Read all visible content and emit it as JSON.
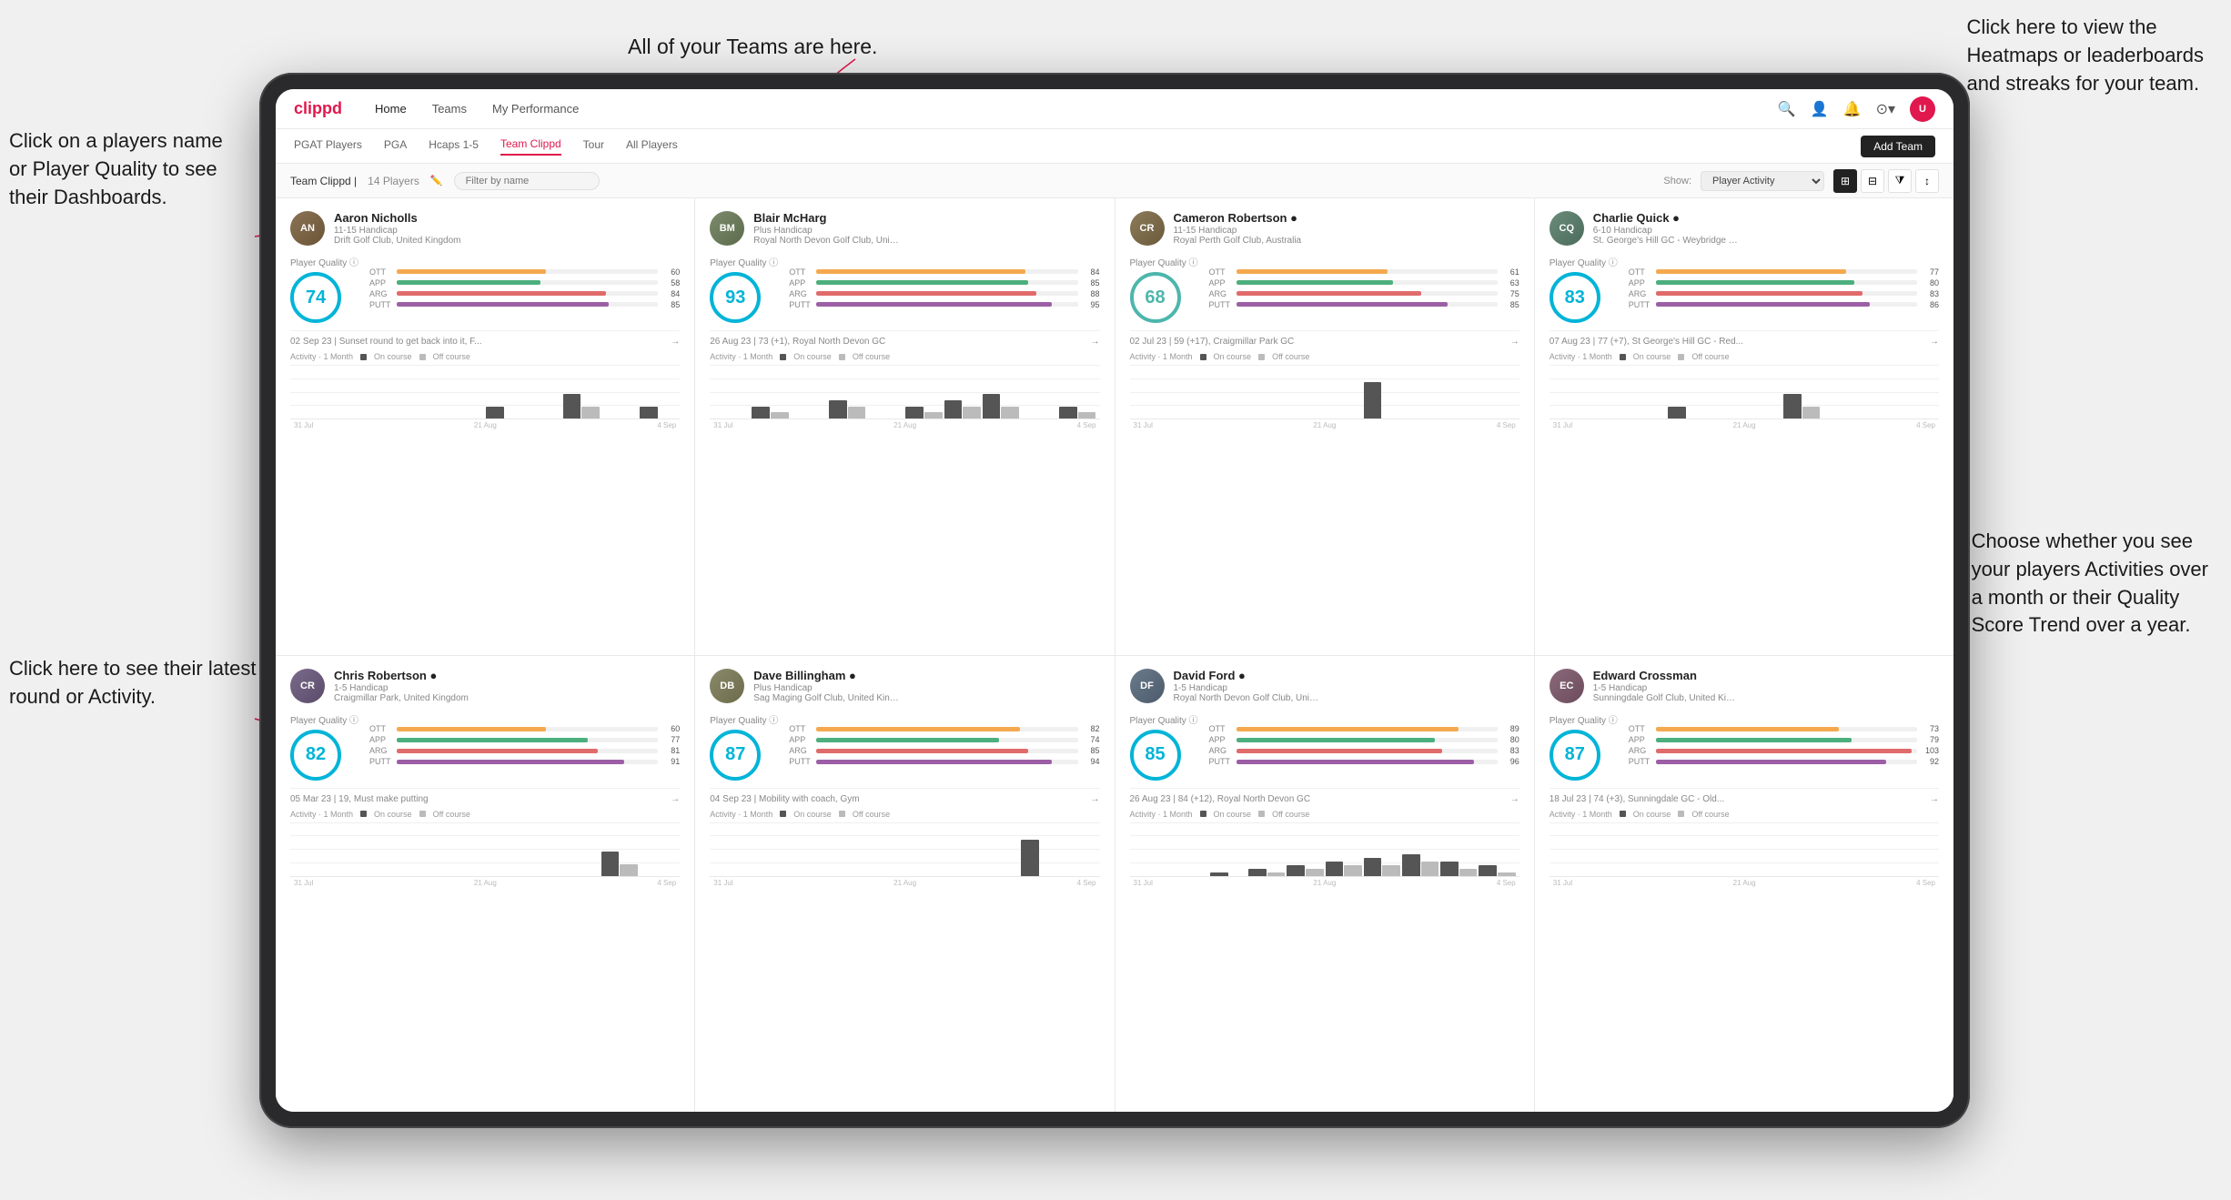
{
  "annotations": {
    "top_teams": "All of your Teams are here.",
    "top_right": "Click here to view the\nHeatmaps or leaderboards\nand streaks for your team.",
    "left_name": "Click on a players name\nor Player Quality to see\ntheir Dashboards.",
    "left_activity": "Click here to see their latest\nround or Activity.",
    "right_bottom": "Choose whether you see\nyour players Activities over\na month or their Quality\nScore Trend over a year."
  },
  "nav": {
    "logo": "clippd",
    "items": [
      "Home",
      "Teams",
      "My Performance"
    ],
    "icons": [
      "🔍",
      "👤",
      "🔔",
      "⊙",
      "👤"
    ]
  },
  "subnav": {
    "items": [
      "PGAT Players",
      "PGA",
      "Hcaps 1-5",
      "Team Clippd",
      "Tour",
      "All Players"
    ],
    "active": "Team Clippd",
    "add_team": "Add Team"
  },
  "teambar": {
    "title": "Team Clippd",
    "count": "14 Players",
    "filter_placeholder": "Filter by name",
    "show_label": "Show:",
    "show_option": "Player Activity",
    "views": [
      "grid-2",
      "grid-3",
      "filter",
      "sort"
    ]
  },
  "players": [
    {
      "name": "Aaron Nicholls",
      "handicap": "11-15 Handicap",
      "club": "Drift Golf Club, United Kingdom",
      "quality": 74,
      "quality_color": "#00b4d8",
      "stats": {
        "ott": 60,
        "app": 58,
        "arg": 84,
        "putt": 85
      },
      "latest": "02 Sep 23 | Sunset round to get back into it, F...",
      "activity_bars": [
        [
          0,
          0
        ],
        [
          0,
          0
        ],
        [
          0,
          0
        ],
        [
          0,
          0
        ],
        [
          0,
          0
        ],
        [
          1,
          0
        ],
        [
          0,
          0
        ],
        [
          2,
          1
        ],
        [
          0,
          0
        ],
        [
          1,
          0
        ]
      ],
      "dates": [
        "31 Jul",
        "21 Aug",
        "4 Sep"
      ],
      "avatar_class": "avatar-a",
      "avatar_letter": "AN"
    },
    {
      "name": "Blair McHarg",
      "handicap": "Plus Handicap",
      "club": "Royal North Devon Golf Club, United Kin...",
      "quality": 93,
      "quality_color": "#00b4d8",
      "stats": {
        "ott": 84,
        "app": 85,
        "arg": 88,
        "putt": 95
      },
      "latest": "26 Aug 23 | 73 (+1), Royal North Devon GC",
      "activity_bars": [
        [
          0,
          0
        ],
        [
          2,
          1
        ],
        [
          0,
          0
        ],
        [
          3,
          2
        ],
        [
          0,
          0
        ],
        [
          2,
          1
        ],
        [
          3,
          2
        ],
        [
          4,
          2
        ],
        [
          0,
          0
        ],
        [
          2,
          1
        ]
      ],
      "dates": [
        "31 Jul",
        "21 Aug",
        "4 Sep"
      ],
      "avatar_class": "avatar-b",
      "avatar_letter": "BM"
    },
    {
      "name": "Cameron Robertson",
      "handicap": "11-15 Handicap",
      "club": "Royal Perth Golf Club, Australia",
      "quality": 68,
      "quality_color": "#4db6ac",
      "stats": {
        "ott": 61,
        "app": 63,
        "arg": 75,
        "putt": 85
      },
      "latest": "02 Jul 23 | 59 (+17), Craigmillar Park GC",
      "activity_bars": [
        [
          0,
          0
        ],
        [
          0,
          0
        ],
        [
          0,
          0
        ],
        [
          0,
          0
        ],
        [
          0,
          0
        ],
        [
          0,
          0
        ],
        [
          1,
          0
        ],
        [
          0,
          0
        ],
        [
          0,
          0
        ],
        [
          0,
          0
        ]
      ],
      "dates": [
        "31 Jul",
        "21 Aug",
        "4 Sep"
      ],
      "avatar_class": "avatar-c",
      "avatar_letter": "CR"
    },
    {
      "name": "Charlie Quick",
      "handicap": "6-10 Handicap",
      "club": "St. George's Hill GC - Weybridge - Surrey...",
      "quality": 83,
      "quality_color": "#00b4d8",
      "stats": {
        "ott": 77,
        "app": 80,
        "arg": 83,
        "putt": 86
      },
      "latest": "07 Aug 23 | 77 (+7), St George's Hill GC - Red...",
      "activity_bars": [
        [
          0,
          0
        ],
        [
          0,
          0
        ],
        [
          0,
          0
        ],
        [
          1,
          0
        ],
        [
          0,
          0
        ],
        [
          0,
          0
        ],
        [
          2,
          1
        ],
        [
          0,
          0
        ],
        [
          0,
          0
        ],
        [
          0,
          0
        ]
      ],
      "dates": [
        "31 Jul",
        "21 Aug",
        "4 Sep"
      ],
      "avatar_class": "avatar-d",
      "avatar_letter": "CQ"
    },
    {
      "name": "Chris Robertson",
      "handicap": "1-5 Handicap",
      "club": "Craigmillar Park, United Kingdom",
      "quality": 82,
      "quality_color": "#00b4d8",
      "stats": {
        "ott": 60,
        "app": 77,
        "arg": 81,
        "putt": 91
      },
      "latest": "05 Mar 23 | 19, Must make putting",
      "activity_bars": [
        [
          0,
          0
        ],
        [
          0,
          0
        ],
        [
          0,
          0
        ],
        [
          0,
          0
        ],
        [
          0,
          0
        ],
        [
          0,
          0
        ],
        [
          0,
          0
        ],
        [
          0,
          0
        ],
        [
          2,
          1
        ],
        [
          0,
          0
        ]
      ],
      "dates": [
        "31 Jul",
        "21 Aug",
        "4 Sep"
      ],
      "avatar_class": "avatar-e",
      "avatar_letter": "CR"
    },
    {
      "name": "Dave Billingham",
      "handicap": "Plus Handicap",
      "club": "Sag Maging Golf Club, United Kingdom",
      "quality": 87,
      "quality_color": "#00b4d8",
      "stats": {
        "ott": 82,
        "app": 74,
        "arg": 85,
        "putt": 94
      },
      "latest": "04 Sep 23 | Mobility with coach, Gym",
      "activity_bars": [
        [
          0,
          0
        ],
        [
          0,
          0
        ],
        [
          0,
          0
        ],
        [
          0,
          0
        ],
        [
          0,
          0
        ],
        [
          0,
          0
        ],
        [
          0,
          0
        ],
        [
          0,
          0
        ],
        [
          1,
          0
        ],
        [
          0,
          0
        ]
      ],
      "dates": [
        "31 Jul",
        "21 Aug",
        "4 Sep"
      ],
      "avatar_class": "avatar-f",
      "avatar_letter": "DB"
    },
    {
      "name": "David Ford",
      "handicap": "1-5 Handicap",
      "club": "Royal North Devon Golf Club, United Kiti...",
      "quality": 85,
      "quality_color": "#00b4d8",
      "stats": {
        "ott": 89,
        "app": 80,
        "arg": 83,
        "putt": 96
      },
      "latest": "26 Aug 23 | 84 (+12), Royal North Devon GC",
      "activity_bars": [
        [
          0,
          0
        ],
        [
          0,
          0
        ],
        [
          1,
          0
        ],
        [
          2,
          1
        ],
        [
          3,
          2
        ],
        [
          4,
          3
        ],
        [
          5,
          3
        ],
        [
          6,
          4
        ],
        [
          4,
          2
        ],
        [
          3,
          1
        ]
      ],
      "dates": [
        "31 Jul",
        "21 Aug",
        "4 Sep"
      ],
      "avatar_class": "avatar-g",
      "avatar_letter": "DF"
    },
    {
      "name": "Edward Crossman",
      "handicap": "1-5 Handicap",
      "club": "Sunningdale Golf Club, United Kingdom",
      "quality": 87,
      "quality_color": "#00b4d8",
      "stats": {
        "ott": 73,
        "app": 79,
        "arg": 103,
        "putt": 92
      },
      "latest": "18 Jul 23 | 74 (+3), Sunningdale GC - Old...",
      "activity_bars": [
        [
          0,
          0
        ],
        [
          0,
          0
        ],
        [
          0,
          0
        ],
        [
          0,
          0
        ],
        [
          0,
          0
        ],
        [
          0,
          0
        ],
        [
          0,
          0
        ],
        [
          0,
          0
        ],
        [
          0,
          0
        ],
        [
          0,
          0
        ]
      ],
      "dates": [
        "31 Jul",
        "21 Aug",
        "4 Sep"
      ],
      "avatar_class": "avatar-h",
      "avatar_letter": "EC"
    }
  ]
}
